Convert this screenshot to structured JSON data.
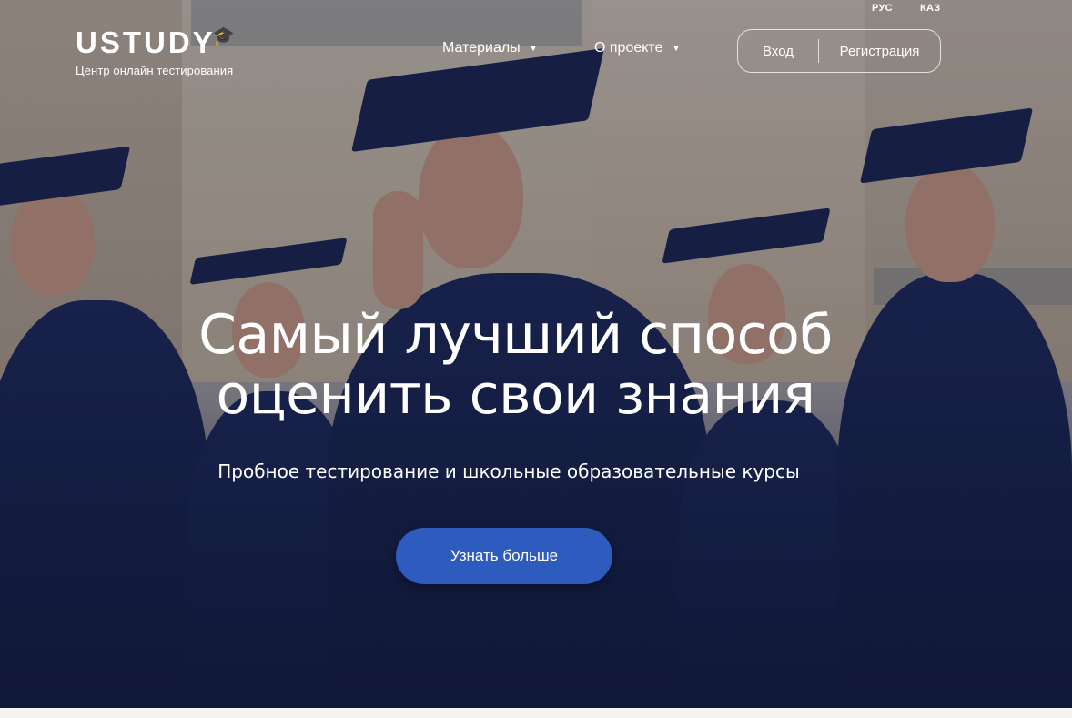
{
  "lang": {
    "ru": "РУС",
    "kz": "КАЗ"
  },
  "logo": {
    "name": "USTUDY",
    "tagline": "Центр онлайн тестирования"
  },
  "nav": {
    "materials": "Материалы",
    "about": "О проекте"
  },
  "auth": {
    "login": "Вход",
    "register": "Регистрация"
  },
  "hero": {
    "line1": "Самый лучший способ",
    "line2": "оценить свои знания",
    "subtitle": "Пробное тестирование и школьные образовательные курсы",
    "cta": "Узнать больше"
  },
  "colors": {
    "accent": "#2d5bbe",
    "gown": "#1e2a5a"
  },
  "icons": {
    "dropdown": "chevron-down-icon",
    "logo_mark": "graduation-cap-icon"
  }
}
